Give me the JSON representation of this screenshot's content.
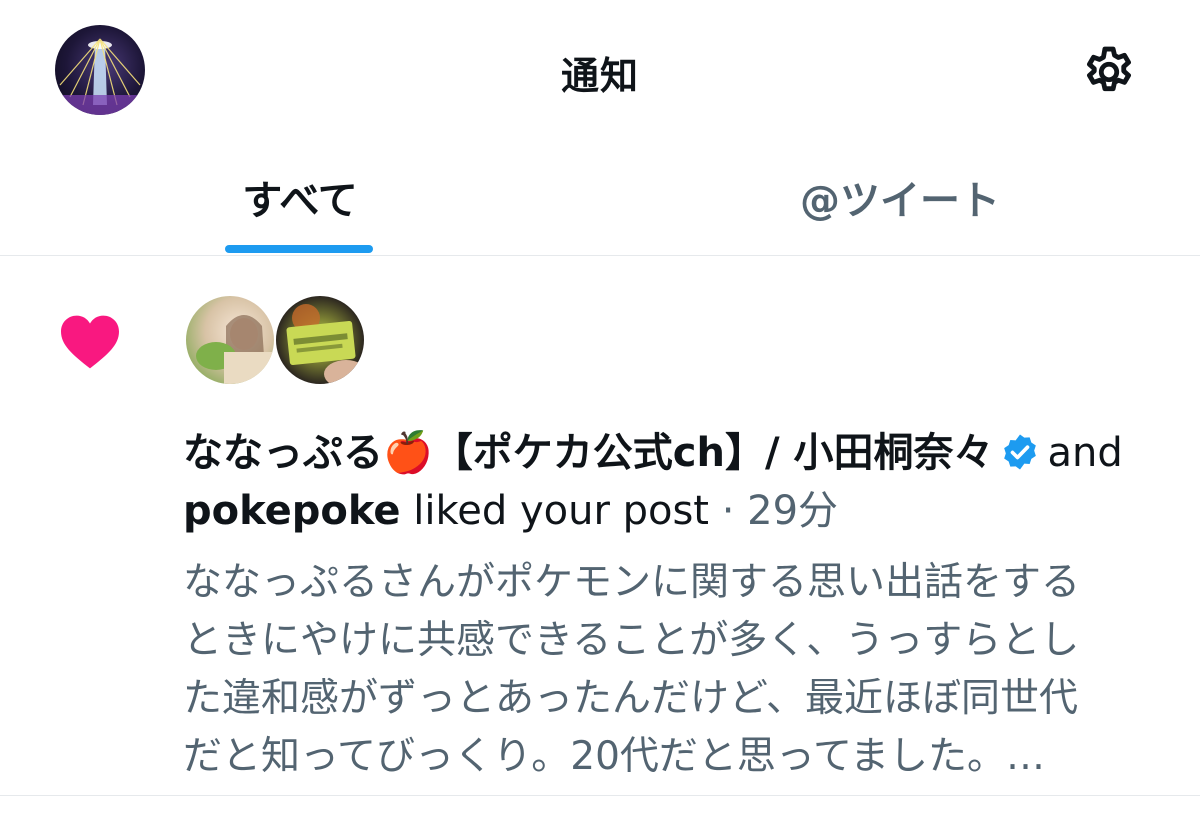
{
  "header": {
    "title": "通知",
    "settings_icon": "gear-icon"
  },
  "tabs": [
    {
      "label": "すべて",
      "active": true
    },
    {
      "label": "@ツイート",
      "active": false
    }
  ],
  "accent_color": "#1d9bf0",
  "notification": {
    "type_icon": "heart-icon",
    "type_color": "#f91880",
    "user1": "ななっぷる🍎【ポケカ公式ch】/ 小田桐奈々",
    "user1_verified": true,
    "joiner": "and",
    "user2": "pokepoke",
    "action": "liked your post",
    "separator": "·",
    "time": "29分",
    "excerpt_lines": [
      "ななっぷるさんがポケモンに関する思い出話をする",
      "ときにやけに共感できることが多く、うっすらとし",
      "た違和感がずっとあったんだけど、最近ほぼ同世代",
      "だと知ってびっくり。20代だと思ってました。…"
    ]
  }
}
